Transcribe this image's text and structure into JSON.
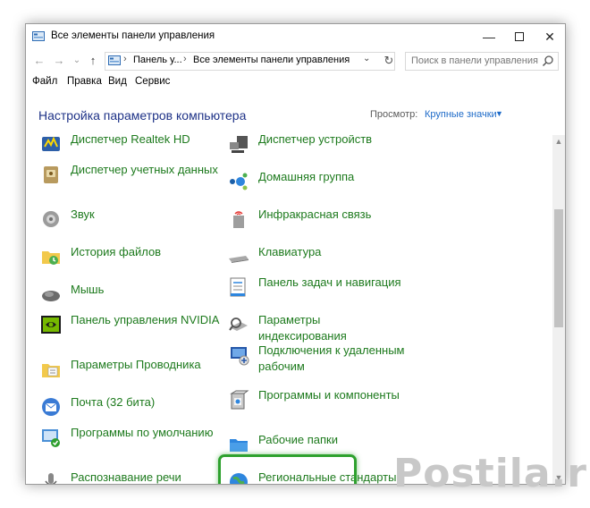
{
  "window": {
    "title": "Все элементы панели управления"
  },
  "address": {
    "crumb1": "Панель у...",
    "separator": "›",
    "crumb2": "Все элементы панели управления",
    "search_placeholder": "Поиск в панели управления"
  },
  "menu": [
    "Файл",
    "Правка",
    "Вид",
    "Сервис"
  ],
  "content": {
    "heading": "Настройка параметров компьютера",
    "view_label": "Просмотр:",
    "view_value": "Крупные значки"
  },
  "items_left": [
    {
      "label": "Диспетчер Realtek HD",
      "icon": "realtek-audio-icon"
    },
    {
      "label": "Диспетчер учетных данных",
      "icon": "credential-manager-icon"
    },
    {
      "label": "Звук",
      "icon": "speaker-icon"
    },
    {
      "label": "История файлов",
      "icon": "file-history-icon"
    },
    {
      "label": "Мышь",
      "icon": "mouse-icon"
    },
    {
      "label": "Панель управления NVIDIA",
      "icon": "nvidia-icon"
    },
    {
      "label": "Параметры Проводника",
      "icon": "folder-options-icon"
    },
    {
      "label": "Почта (32 бита)",
      "icon": "mail-icon"
    },
    {
      "label": "Программы по умолчанию",
      "icon": "default-programs-icon"
    },
    {
      "label": "Распознавание речи",
      "icon": "speech-recognition-icon"
    }
  ],
  "items_right": [
    {
      "label": "Диспетчер устройств",
      "icon": "device-manager-icon"
    },
    {
      "label": "Домашняя группа",
      "icon": "homegroup-icon"
    },
    {
      "label": "Инфракрасная связь",
      "icon": "infrared-icon"
    },
    {
      "label": "Клавиатура",
      "icon": "keyboard-icon"
    },
    {
      "label": "Панель задач и навигация",
      "icon": "taskbar-icon"
    },
    {
      "label": "Параметры индексирования",
      "icon": "indexing-icon"
    },
    {
      "label": "Подключения к удаленным рабочим",
      "icon": "remote-desktop-icon"
    },
    {
      "label": "Программы и компоненты",
      "icon": "programs-features-icon"
    },
    {
      "label": "Рабочие папки",
      "icon": "work-folders-icon"
    },
    {
      "label": "Региональные стандарты",
      "icon": "region-icon"
    }
  ],
  "watermark": "Postila.ru"
}
